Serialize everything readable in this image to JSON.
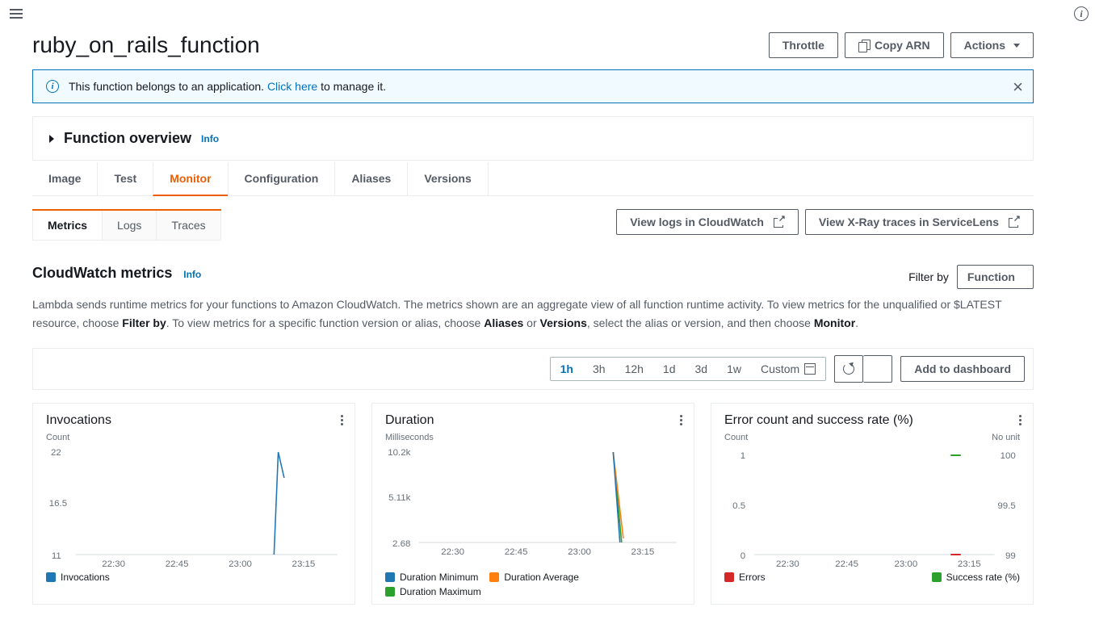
{
  "page_title": "ruby_on_rails_function",
  "header_buttons": {
    "throttle": "Throttle",
    "copy_arn": "Copy ARN",
    "actions": "Actions"
  },
  "alert": {
    "text_before": "This function belongs to an application. ",
    "link": "Click here",
    "text_after": " to manage it."
  },
  "overview": {
    "title": "Function overview",
    "info": "Info"
  },
  "tabs": [
    "Image",
    "Test",
    "Monitor",
    "Configuration",
    "Aliases",
    "Versions"
  ],
  "active_tab": "Monitor",
  "subtabs": [
    "Metrics",
    "Logs",
    "Traces"
  ],
  "active_subtab": "Metrics",
  "ext_buttons": {
    "cloudwatch": "View logs in CloudWatch",
    "xray": "View X-Ray traces in ServiceLens"
  },
  "metrics_section": {
    "title": "CloudWatch metrics",
    "info": "Info",
    "filter_label": "Filter by",
    "filter_value": "Function",
    "description": {
      "p1": "Lambda sends runtime metrics for your functions to Amazon CloudWatch. The metrics shown are an aggregate view of all function runtime activity. To view metrics for the unqualified or $LATEST resource, choose ",
      "b1": "Filter by",
      "p2": ". To view metrics for a specific function version or alias, choose ",
      "b2": "Aliases",
      "p3": " or ",
      "b3": "Versions",
      "p4": ", select the alias or version, and then choose ",
      "b4": "Monitor",
      "p5": "."
    }
  },
  "time_ranges": [
    "1h",
    "3h",
    "12h",
    "1d",
    "3d",
    "1w",
    "Custom"
  ],
  "active_range": "1h",
  "add_dashboard": "Add to dashboard",
  "charts": {
    "invocations": {
      "title": "Invocations",
      "ylabel": "Count",
      "legend": [
        {
          "label": "Invocations",
          "color": "#1f77b4"
        }
      ]
    },
    "duration": {
      "title": "Duration",
      "ylabel": "Milliseconds",
      "legend": [
        {
          "label": "Duration Minimum",
          "color": "#1f77b4"
        },
        {
          "label": "Duration Average",
          "color": "#ff7f0e"
        },
        {
          "label": "Duration Maximum",
          "color": "#2ca02c"
        }
      ]
    },
    "errors": {
      "title": "Error count and success rate (%)",
      "ylabel_left": "Count",
      "ylabel_right": "No unit",
      "legend": [
        {
          "label": "Errors",
          "color": "#d62728"
        },
        {
          "label": "Success rate (%)",
          "color": "#2ca02c"
        }
      ]
    }
  },
  "chart_data": [
    {
      "type": "line",
      "title": "Invocations",
      "xlabel": "",
      "ylabel": "Count",
      "x_ticks": [
        "22:30",
        "22:45",
        "23:00",
        "23:15"
      ],
      "y_ticks": [
        11,
        16.5,
        22
      ],
      "ylim": [
        11,
        22
      ],
      "series": [
        {
          "name": "Invocations",
          "color": "#1f77b4",
          "x": [
            "23:06",
            "23:07",
            "23:08"
          ],
          "values": [
            11,
            22,
            19
          ]
        }
      ]
    },
    {
      "type": "line",
      "title": "Duration",
      "xlabel": "",
      "ylabel": "Milliseconds",
      "x_ticks": [
        "22:30",
        "22:45",
        "23:00",
        "23:15"
      ],
      "y_ticks": [
        2.68,
        5.11,
        10.2
      ],
      "y_tick_labels": [
        "2.68",
        "5.11k",
        "10.2k"
      ],
      "ylim": [
        2.68,
        10200
      ],
      "series": [
        {
          "name": "Duration Minimum",
          "color": "#1f77b4",
          "x": [
            "23:06",
            "23:08"
          ],
          "values": [
            10200,
            2.68
          ]
        },
        {
          "name": "Duration Average",
          "color": "#ff7f0e",
          "x": [
            "23:06",
            "23:08"
          ],
          "values": [
            10200,
            300
          ]
        },
        {
          "name": "Duration Maximum",
          "color": "#2ca02c",
          "x": [
            "23:06",
            "23:08"
          ],
          "values": [
            10200,
            2.68
          ]
        }
      ]
    },
    {
      "type": "line",
      "title": "Error count and success rate (%)",
      "xlabel": "",
      "ylabel": "Count",
      "ylabel2": "No unit",
      "x_ticks": [
        "22:30",
        "22:45",
        "23:00",
        "23:15"
      ],
      "y_ticks_left": [
        0,
        0.5,
        1
      ],
      "y_ticks_right": [
        99,
        99.5,
        100
      ],
      "series": [
        {
          "name": "Errors",
          "color": "#d62728",
          "axis": "left",
          "x": [
            "23:07",
            "23:08"
          ],
          "values": [
            0,
            0
          ]
        },
        {
          "name": "Success rate (%)",
          "color": "#2ca02c",
          "axis": "right",
          "x": [
            "23:07",
            "23:08"
          ],
          "values": [
            100,
            100
          ]
        }
      ]
    }
  ]
}
